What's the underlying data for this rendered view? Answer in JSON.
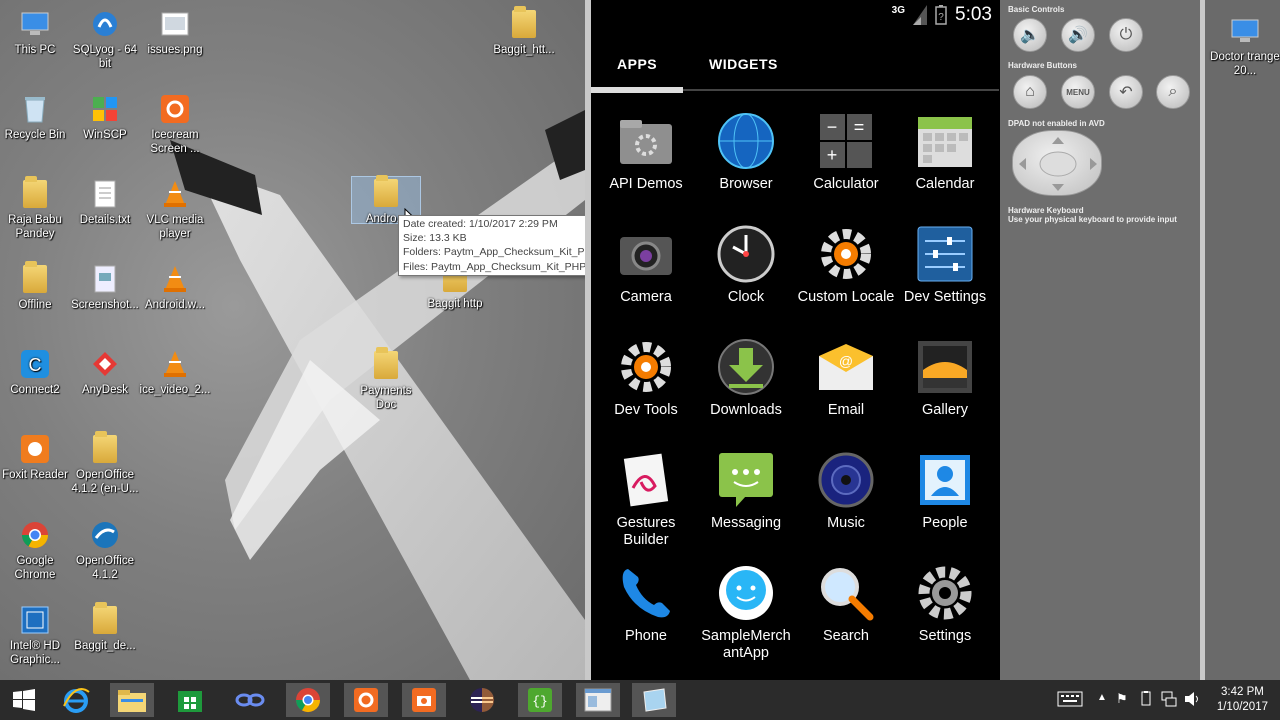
{
  "desktop": {
    "icons": [
      {
        "label": "This PC",
        "icon": "computer-icon"
      },
      {
        "label": "SQLyog - 64 bit",
        "icon": "sqlyog-icon"
      },
      {
        "label": "issues.png",
        "icon": "image-file-icon"
      },
      {
        "label": "Baggit_htt...",
        "icon": "folder-icon"
      },
      {
        "label": "Recycle Bin",
        "icon": "recycle-bin-icon"
      },
      {
        "label": "WinSCP",
        "icon": "winscp-icon"
      },
      {
        "label": "Icecream Screen ...",
        "icon": "icecream-icon"
      },
      {
        "label": "Raja Babu Pandey",
        "icon": "user-folder-icon"
      },
      {
        "label": "Details.txt",
        "icon": "text-file-icon"
      },
      {
        "label": "VLC media player",
        "icon": "vlc-icon"
      },
      {
        "label": "Andro...",
        "icon": "folder-icon"
      },
      {
        "label": "Offline",
        "icon": "folder-icon"
      },
      {
        "label": "Screenshot...",
        "icon": "file-icon"
      },
      {
        "label": "Android.w...",
        "icon": "vlc-icon"
      },
      {
        "label": "Baggit http",
        "icon": "folder-icon"
      },
      {
        "label": "Connect2",
        "icon": "connect-icon"
      },
      {
        "label": "AnyDesk",
        "icon": "anydesk-icon"
      },
      {
        "label": "ice_video_2...",
        "icon": "vlc-icon"
      },
      {
        "label": "Payments Doc",
        "icon": "folder-icon"
      },
      {
        "label": "Foxit Reader",
        "icon": "foxit-icon"
      },
      {
        "label": "OpenOffice 4.1.2 (en-U...",
        "icon": "folder-icon"
      },
      {
        "label": "Google Chrome",
        "icon": "chrome-icon"
      },
      {
        "label": "OpenOffice 4.1.2",
        "icon": "openoffice-icon"
      },
      {
        "label": "Intel® HD Graphic...",
        "icon": "intel-icon"
      },
      {
        "label": "Baggit_de...",
        "icon": "folder-icon"
      },
      {
        "label": "Doctor trange 20...",
        "icon": "computer-icon"
      }
    ],
    "tooltip": [
      "Date created: 1/10/2017 2:29 PM",
      "Size: 13.3 KB",
      "Folders: Paytm_App_Checksum_Kit_PHP-master",
      "Files: Paytm_App_Checksum_Kit_PHP-master.zip"
    ]
  },
  "android": {
    "status_signal": "3G",
    "status_time": "5:03",
    "tabs": [
      "APPS",
      "WIDGETS"
    ],
    "apps": [
      "API Demos",
      "Browser",
      "Calculator",
      "Calendar",
      "Camera",
      "Clock",
      "Custom Locale",
      "Dev Settings",
      "Dev Tools",
      "Downloads",
      "Email",
      "Gallery",
      "Gestures Builder",
      "Messaging",
      "Music",
      "People",
      "Phone",
      "SampleMerchantApp",
      "Search",
      "Settings"
    ]
  },
  "controls": {
    "basic_label": "Basic Controls",
    "hardware_buttons_label": "Hardware Buttons",
    "menu_label": "MENU",
    "dpad_label": "DPAD not enabled in AVD",
    "keyboard_label": "Hardware Keyboard",
    "keyboard_hint": "Use your physical keyboard to provide input"
  },
  "taskbar": {
    "time": "3:42 PM",
    "date": "1/10/2017"
  },
  "colors": {
    "taskbar": "#2b2b2b",
    "android_bg": "#000000",
    "accent_blue": "#1e88e5"
  }
}
